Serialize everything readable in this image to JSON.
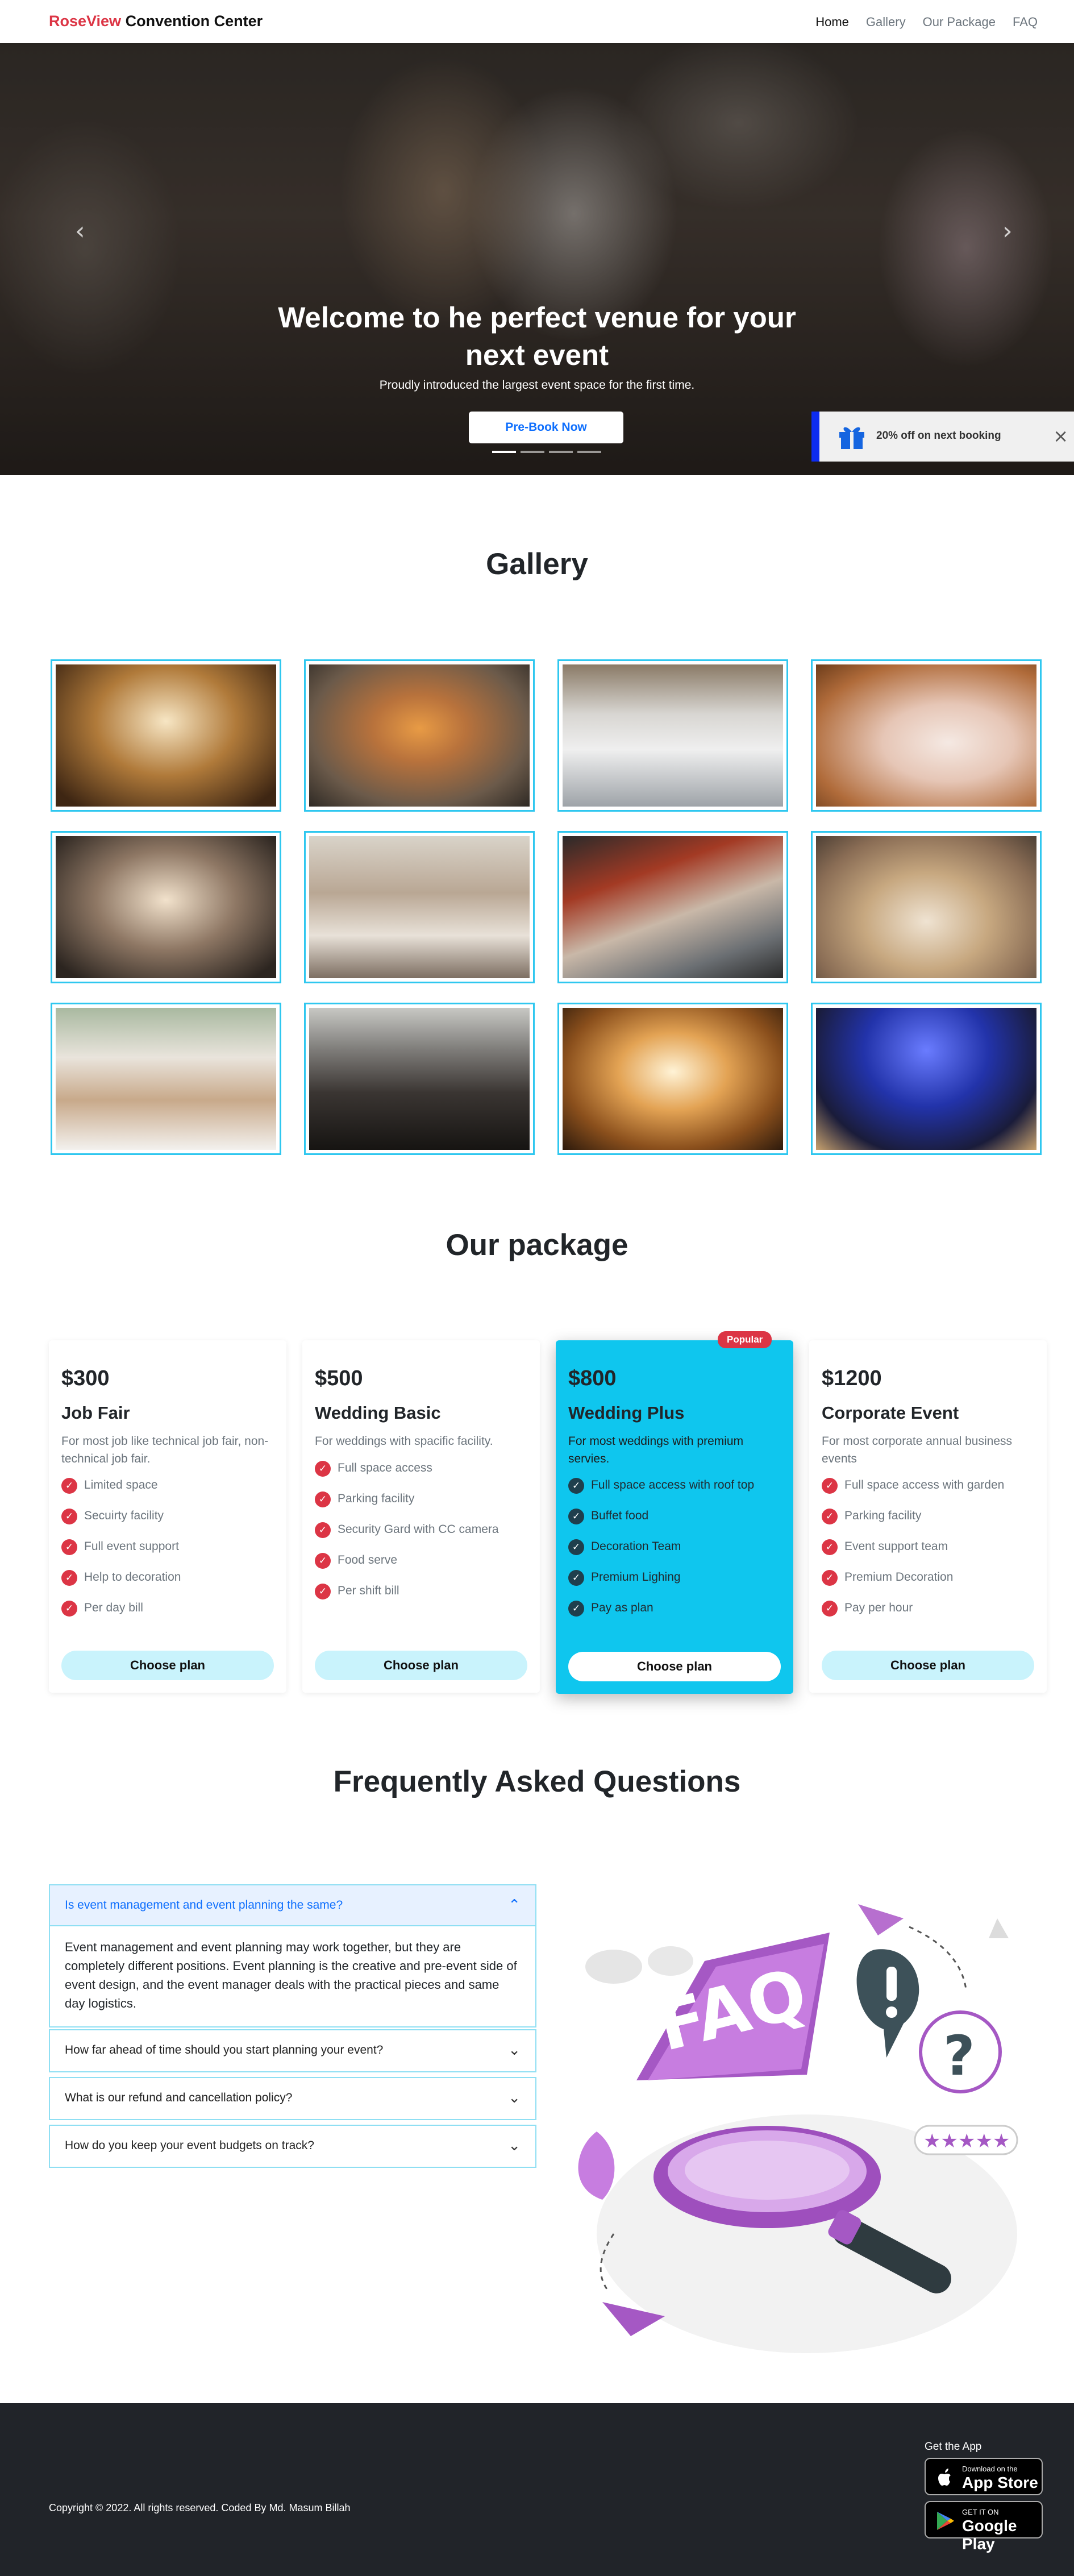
{
  "navbar": {
    "brand_accent": "RoseView",
    "brand_rest": " Convention Center",
    "links": [
      "Home",
      "Gallery",
      "Our Package",
      "FAQ"
    ]
  },
  "hero": {
    "title": "Welcome to he perfect venue for your next event",
    "subtitle": "Proudly introduced the largest event space for the first time.",
    "button": "Pre-Book Now",
    "prev_icon": "‹",
    "next_icon": "›",
    "slide_count": 4,
    "active_slide": 1
  },
  "promo": {
    "text": "20% off on next booking",
    "icon": "gift-icon",
    "close": "×"
  },
  "gallery": {
    "title": "Gallery",
    "images": [
      "barn-hall-lights",
      "table-centerpiece",
      "conference-hall",
      "bride-bouquet",
      "rustic-barn-interior",
      "banquet-tables",
      "buffet-food",
      "round-tables-hall",
      "outdoor-aisle",
      "auditorium-audience",
      "stage-chandelier",
      "concert-crowd"
    ]
  },
  "packages": {
    "title": "Our package",
    "popular_label": "Popular",
    "choose_label": "Choose plan",
    "items": [
      {
        "price": "$300",
        "name": "Job Fair",
        "desc": "For most job like technical job fair, non-technical job fair.",
        "features": [
          "Limited space",
          "Secuirty facility",
          "Full event support",
          "Help to decoration",
          "Per day bill"
        ]
      },
      {
        "price": "$500",
        "name": "Wedding Basic",
        "desc": "For weddings with spacific facility.",
        "features": [
          "Full space access",
          "Parking facility",
          "Security Gard with CC camera",
          "Food serve",
          "Per shift bill"
        ]
      },
      {
        "price": "$800",
        "name": "Wedding Plus",
        "desc": "For most weddings with premium servies.",
        "features": [
          "Full space access with roof top",
          "Buffet food",
          "Decoration Team",
          "Premium Lighing",
          "Pay as plan"
        ]
      },
      {
        "price": "$1200",
        "name": "Corporate Event",
        "desc": "For most corporate annual business events",
        "features": [
          "Full space access with garden",
          "Parking facility",
          "Event support team",
          "Premium Decoration",
          "Pay per hour"
        ]
      }
    ]
  },
  "faq": {
    "title": "Frequently Asked Questions",
    "items": [
      {
        "q": "Is event management and event planning the same?",
        "a": "Event management and event planning may work together, but they are completely different positions. Event planning is the creative and pre-event side of event design, and the event manager deals with the practical pieces and same day logistics."
      },
      {
        "q": "How far ahead of time should you start planning your event?"
      },
      {
        "q": "What is our refund and cancellation policy?"
      },
      {
        "q": "How do you keep your event budgets on track?"
      }
    ],
    "illustration_text": "FAQ"
  },
  "footer": {
    "copyright": "Copyright © 2022. All rights reserved. Coded By Md. Masum Billah",
    "get_app": "Get the App",
    "app_store_small": "Download on the",
    "app_store_big": "App Store",
    "play_small": "GET IT ON",
    "play_big": "Google Play"
  },
  "colors": {
    "accent_red": "#dc3545",
    "cyan": "#0fc6ee",
    "primary_blue": "#0d6efd",
    "footer_bg": "#212429"
  }
}
